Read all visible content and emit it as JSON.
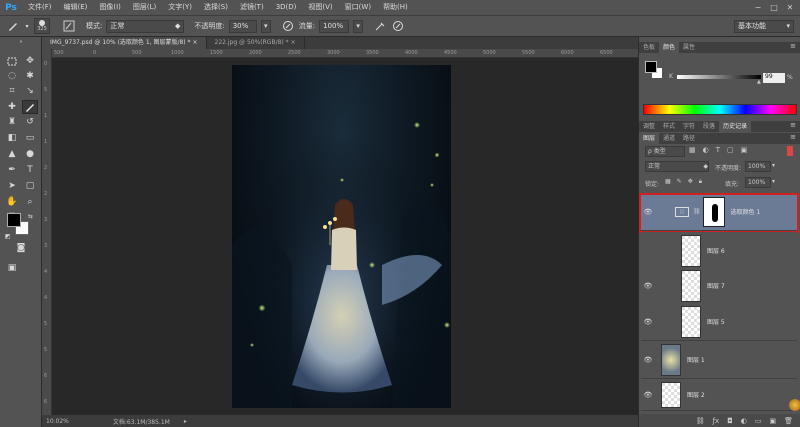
{
  "app": {
    "logo": "Ps"
  },
  "menu": [
    "文件(F)",
    "编辑(E)",
    "图像(I)",
    "图层(L)",
    "文字(Y)",
    "选择(S)",
    "滤镜(T)",
    "3D(D)",
    "视图(V)",
    "窗口(W)",
    "帮助(H)"
  ],
  "window_controls": {
    "minimize": "−",
    "maximize": "□",
    "close": "✕"
  },
  "options": {
    "brush_size": "325",
    "mode_label": "模式:",
    "mode_value": "正常",
    "opacity_label": "不透明度:",
    "opacity_value": "30%",
    "flow_label": "流量:",
    "flow_value": "100%",
    "workspace": "基本功能"
  },
  "tabs": [
    {
      "label": "IMG_9737.psd @ 10% (选取颜色 1, 图层蒙版/8) *",
      "close": "×"
    },
    {
      "label": "222.jpg @ 50%(RGB/8) *",
      "close": "×"
    }
  ],
  "ruler": {
    "h": [
      "500",
      "0",
      "500",
      "1000",
      "1500",
      "2000",
      "2500",
      "3000",
      "3500",
      "4000",
      "4500",
      "5000",
      "5500",
      "6000",
      "6500"
    ],
    "v": [
      "0",
      "5",
      "1",
      "1",
      "2",
      "2",
      "3",
      "3",
      "4",
      "4",
      "5",
      "5",
      "6",
      "6"
    ]
  },
  "status": {
    "zoom": "10.02%",
    "doc": "文档:63.1M/385.1M"
  },
  "color_panel": {
    "tabs": [
      "色板",
      "颜色",
      "属性"
    ],
    "active": 1,
    "channel": "K",
    "value": "99",
    "value_suffix": "%"
  },
  "panel_group2": {
    "tabs": [
      "调整",
      "样式",
      "字符",
      "段落",
      "历史记录"
    ],
    "active": 4
  },
  "layers_panel": {
    "tabs": [
      "图层",
      "通道",
      "路径"
    ],
    "active": 0,
    "filter_label": "ρ 类型",
    "blend": "正常",
    "opacity_label": "不透明度:",
    "opacity": "100%",
    "lock_label": "锁定:",
    "fill_label": "填充:",
    "fill": "100%",
    "layers": [
      {
        "name": "选取颜色 1",
        "selected": true,
        "adjustment": true
      },
      {
        "name": "图层 6",
        "selected": false
      },
      {
        "name": "图层 7",
        "selected": false
      },
      {
        "name": "图层 5",
        "selected": false
      },
      {
        "name": "图层 1",
        "selected": false
      },
      {
        "name": "图层 2",
        "selected": false
      }
    ]
  },
  "colors": {
    "highlight": "#d02020",
    "selected_layer": "#6b7b96"
  }
}
